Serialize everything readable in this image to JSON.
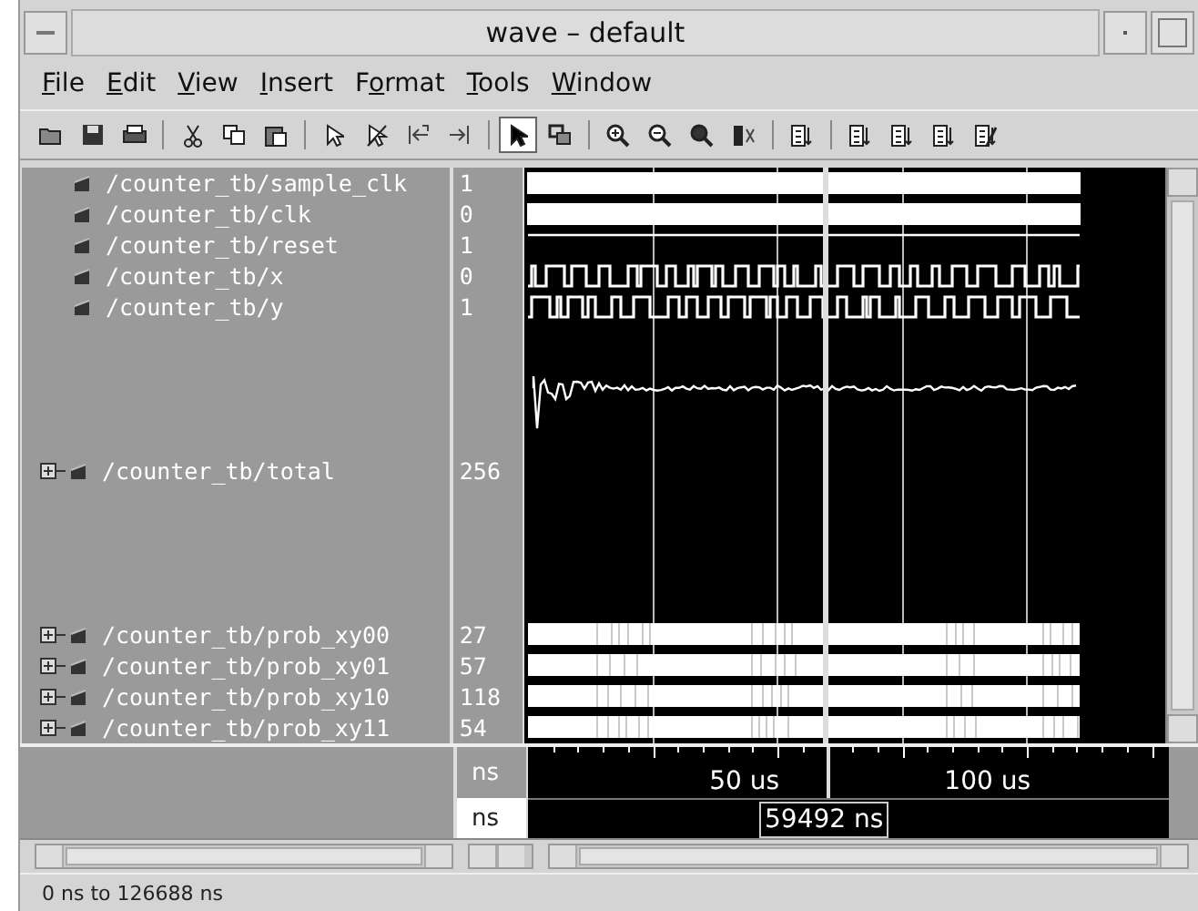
{
  "window": {
    "title": "wave – default"
  },
  "menu": [
    {
      "key": "F",
      "post": "ile"
    },
    {
      "key": "E",
      "post": "dit"
    },
    {
      "key": "V",
      "post": "iew"
    },
    {
      "key": "I",
      "post": "nsert"
    },
    {
      "pre": "F",
      "key": "o",
      "post": "rmat"
    },
    {
      "key": "T",
      "post": "ools"
    },
    {
      "key": "W",
      "post": "indow"
    }
  ],
  "toolbar": [
    {
      "kind": "open",
      "pressed": false
    },
    {
      "kind": "save",
      "pressed": false
    },
    {
      "kind": "print",
      "pressed": false
    },
    {
      "kind": "sep"
    },
    {
      "kind": "cut",
      "pressed": false
    },
    {
      "kind": "copy",
      "pressed": false
    },
    {
      "kind": "paste",
      "pressed": false
    },
    {
      "kind": "sep"
    },
    {
      "kind": "arrow",
      "pressed": false
    },
    {
      "kind": "arrow-x",
      "pressed": false
    },
    {
      "kind": "step-left",
      "pressed": false
    },
    {
      "kind": "step-right",
      "pressed": false
    },
    {
      "kind": "sep"
    },
    {
      "kind": "pointer",
      "pressed": true
    },
    {
      "kind": "zoom-box",
      "pressed": false
    },
    {
      "kind": "sep"
    },
    {
      "kind": "zoom-in",
      "pressed": false
    },
    {
      "kind": "zoom-out",
      "pressed": false
    },
    {
      "kind": "zoom-full",
      "pressed": false
    },
    {
      "kind": "marker",
      "pressed": false
    },
    {
      "kind": "sep"
    },
    {
      "kind": "list",
      "pressed": false
    },
    {
      "kind": "sep"
    },
    {
      "kind": "list",
      "pressed": false
    },
    {
      "kind": "list",
      "pressed": false
    },
    {
      "kind": "list",
      "pressed": false
    },
    {
      "kind": "list-x",
      "pressed": false
    }
  ],
  "signals": [
    {
      "name": "/counter_tb/sample_clk",
      "value": "1",
      "kind": "clock",
      "expandable": false
    },
    {
      "name": "/counter_tb/clk",
      "value": "0",
      "kind": "clock",
      "expandable": false
    },
    {
      "name": "/counter_tb/reset",
      "value": "1",
      "kind": "high",
      "expandable": false
    },
    {
      "name": "/counter_tb/x",
      "value": "0",
      "kind": "bits",
      "expandable": false
    },
    {
      "name": "/counter_tb/y",
      "value": "1",
      "kind": "bits",
      "expandable": false
    },
    {
      "name": "/counter_tb/total",
      "value": "256",
      "kind": "analog",
      "expandable": true
    },
    {
      "name": "/counter_tb/prob_xy00",
      "value": "27",
      "kind": "bus",
      "expandable": true
    },
    {
      "name": "/counter_tb/prob_xy01",
      "value": "57",
      "kind": "bus",
      "expandable": true
    },
    {
      "name": "/counter_tb/prob_xy10",
      "value": "118",
      "kind": "bus",
      "expandable": true
    },
    {
      "name": "/counter_tb/prob_xy11",
      "value": "54",
      "kind": "bus",
      "expandable": true
    }
  ],
  "timeline": {
    "unit": "ns",
    "labels": [
      "50 us",
      "100 us"
    ]
  },
  "cursor": {
    "unit": "ns",
    "readout": "59492 ns"
  },
  "status_bar": "0 ns to 126688 ns"
}
